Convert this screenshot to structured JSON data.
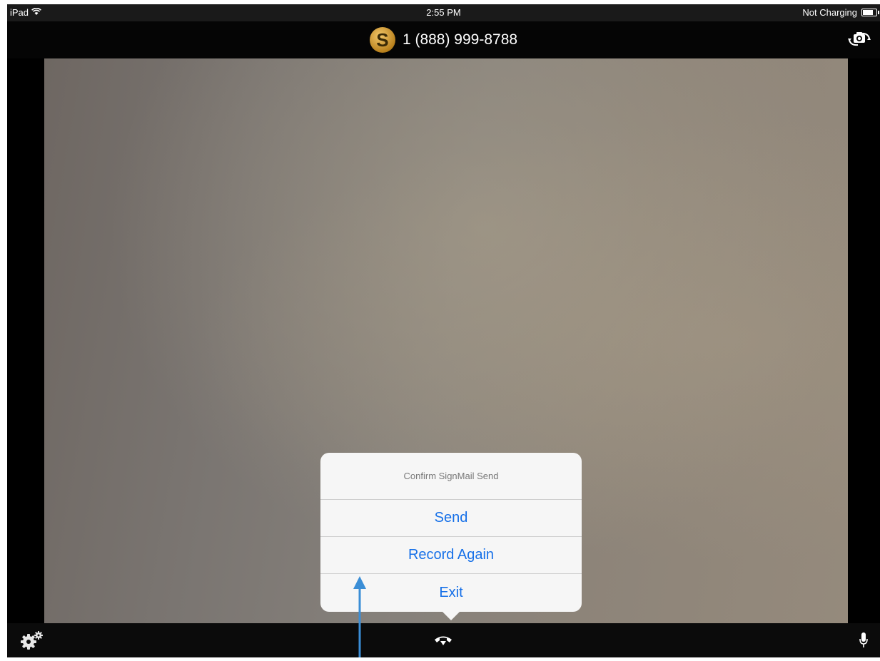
{
  "status_bar": {
    "device": "iPad",
    "time": "2:55 PM",
    "battery_text": "Not Charging",
    "battery_level": 0.85
  },
  "header": {
    "logo_letter": "S",
    "phone_number": "1 (888) 999-8788"
  },
  "popover": {
    "title": "Confirm SignMail Send",
    "buttons": [
      "Send",
      "Record Again",
      "Exit"
    ]
  },
  "icons": {
    "wifi": "wifi-icon",
    "battery": "battery-icon",
    "camera_flip": "camera-flip-icon",
    "settings": "settings-gears-icon",
    "hangup": "hang-up-icon",
    "microphone": "microphone-icon",
    "annotation": "blue-up-arrow-icon"
  },
  "colors": {
    "accent_blue": "#1670e8",
    "logo_gold": "#c8911f",
    "annotation_blue": "#3b8ed6"
  }
}
